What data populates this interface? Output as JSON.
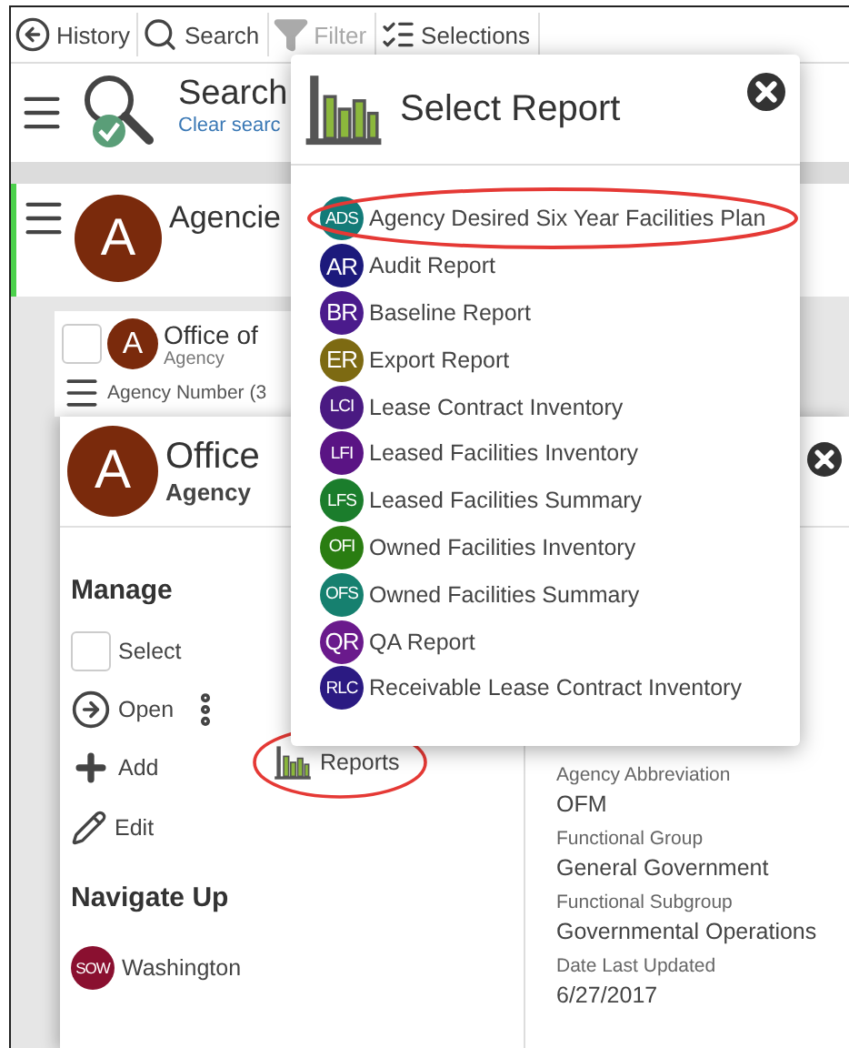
{
  "toolbar": [
    {
      "kind": "history",
      "label": "History",
      "disabled": false
    },
    {
      "kind": "search",
      "label": "Search",
      "disabled": false
    },
    {
      "kind": "filter",
      "label": "Filter",
      "disabled": true
    },
    {
      "kind": "selections",
      "label": "Selections",
      "disabled": false
    }
  ],
  "search_header": {
    "title": "Search",
    "link": "Clear searc"
  },
  "agencies_panel": {
    "avatar": "A",
    "title": "Agencie"
  },
  "list_card": {
    "avatar": "A",
    "title": "Office of",
    "subtitle": "Agency",
    "checked": false,
    "column_label": "Agency Number (3"
  },
  "detail_card": {
    "avatar": "A",
    "title": "Office",
    "subtitle": "Agency",
    "manage_heading": "Manage",
    "actions": [
      {
        "kind": "select",
        "label": "Select",
        "checked": false
      },
      {
        "kind": "open",
        "label": "Open"
      },
      {
        "kind": "add",
        "label": "Add"
      },
      {
        "kind": "edit",
        "label": "Edit"
      }
    ],
    "reports": {
      "label": "Reports",
      "highlighted": true
    },
    "navigate_heading": "Navigate Up",
    "navigate_items": [
      {
        "badge": "SOW",
        "label": "Washington"
      }
    ],
    "fields": [
      {
        "label": "Agency Abbreviation",
        "value": "OFM"
      },
      {
        "label": "Functional Group",
        "value": "General Government"
      },
      {
        "label": "Functional Subgroup",
        "value": "Governmental Operations"
      },
      {
        "label": "Date Last Updated",
        "value": "6/27/2017"
      }
    ]
  },
  "report_dialog": {
    "title": "Select Report",
    "items": [
      {
        "badge": "ADS",
        "label": "Agency Desired Six Year Facilities Plan",
        "color": "#137b78",
        "highlighted": true
      },
      {
        "badge": "AR",
        "label": "Audit Report",
        "color": "#1c1a7c",
        "highlighted": false
      },
      {
        "badge": "BR",
        "label": "Baseline Report",
        "color": "#4b1b8c",
        "highlighted": false
      },
      {
        "badge": "ER",
        "label": "Export Report",
        "color": "#7d6a12",
        "highlighted": false
      },
      {
        "badge": "LCI",
        "label": "Lease Contract Inventory",
        "color": "#4a1a82",
        "highlighted": false
      },
      {
        "badge": "LFI",
        "label": "Leased Facilities Inventory",
        "color": "#5a1484",
        "highlighted": false
      },
      {
        "badge": "LFS",
        "label": "Leased Facilities Summary",
        "color": "#1b7d2c",
        "highlighted": false
      },
      {
        "badge": "OFI",
        "label": "Owned Facilities Inventory",
        "color": "#2a7d12",
        "highlighted": false
      },
      {
        "badge": "OFS",
        "label": "Owned Facilities Summary",
        "color": "#16806f",
        "highlighted": false
      },
      {
        "badge": "QR",
        "label": "QA Report",
        "color": "#6a1a8c",
        "highlighted": false
      },
      {
        "badge": "RLC",
        "label": "Receivable Lease Contract Inventory",
        "color": "#2b1a82",
        "highlighted": false
      }
    ]
  }
}
